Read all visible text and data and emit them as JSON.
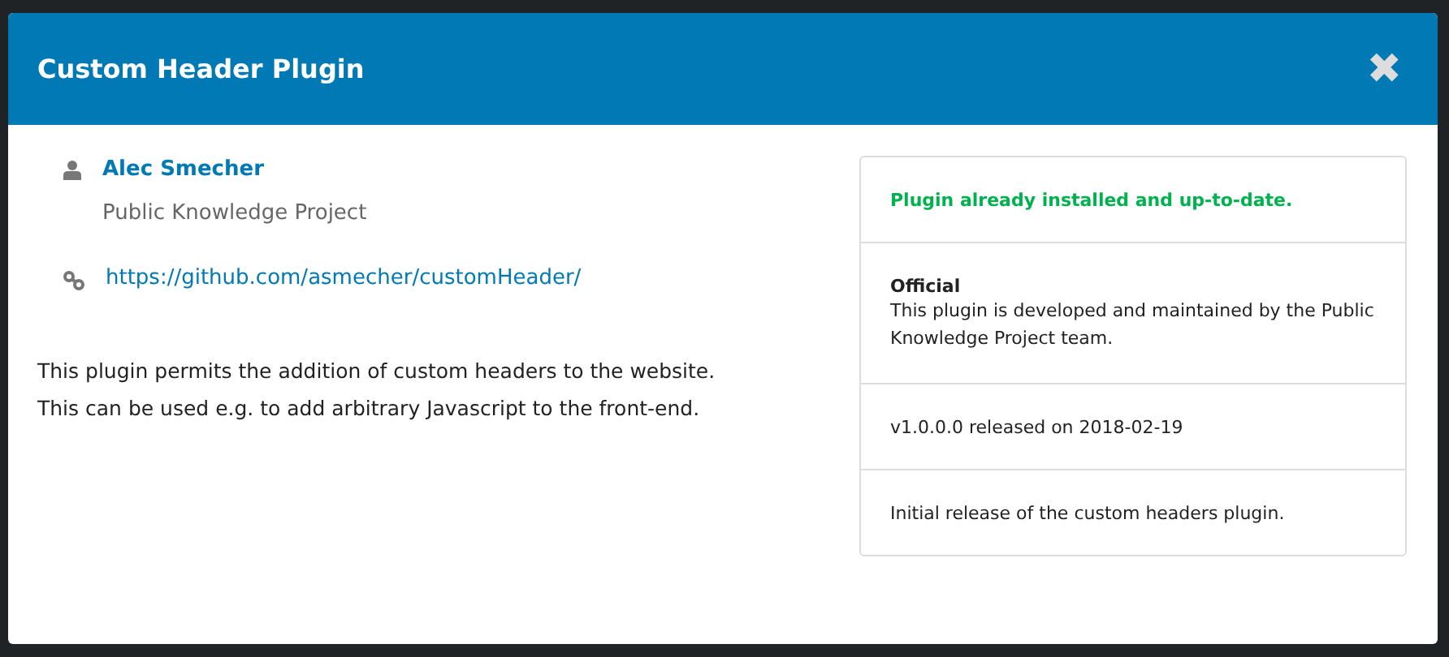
{
  "modal": {
    "title": "Custom Header Plugin",
    "close_label": "✖"
  },
  "author": {
    "name": "Alec Smecher",
    "organization": "Public Knowledge Project"
  },
  "homepage": "https://github.com/asmecher/customHeader/",
  "description": [
    "This plugin permits the addition of custom headers to the website.",
    "This can be used e.g. to add arbitrary Javascript to the front-end."
  ],
  "panel": [
    {
      "kind": "status",
      "text": "Plugin already installed and up-to-date."
    },
    {
      "kind": "official",
      "heading": "Official",
      "text": "This plugin is developed and maintained by the Public Knowledge Project team."
    },
    {
      "kind": "plain",
      "text": "v1.0.0.0 released on 2018-02-19"
    },
    {
      "kind": "plain",
      "text": "Initial release of the custom headers plugin."
    }
  ]
}
